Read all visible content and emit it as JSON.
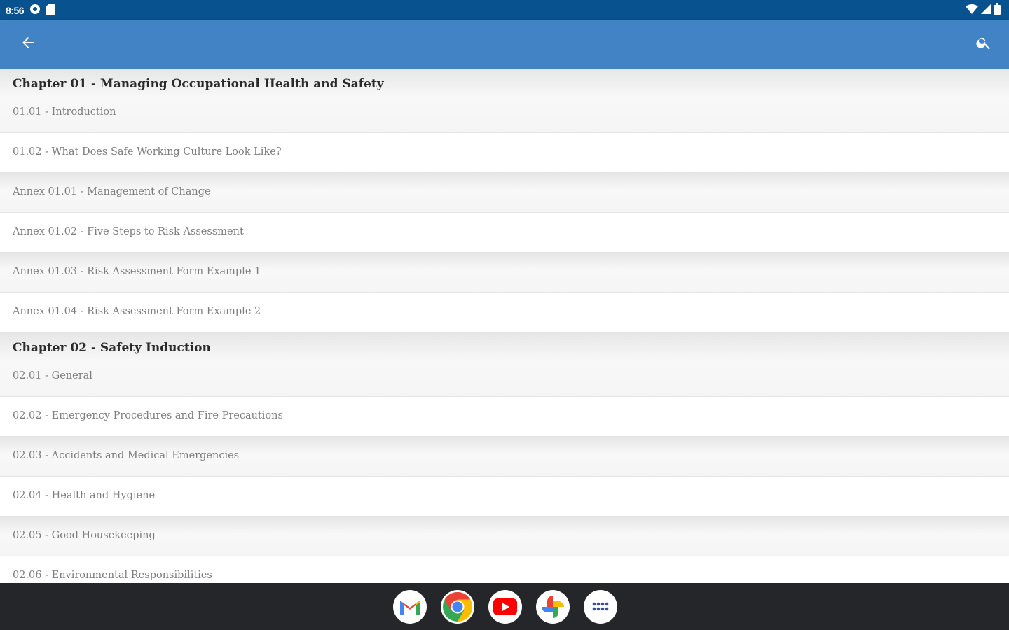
{
  "status_bar": {
    "time": "8:56",
    "icons_left": [
      "settings-icon",
      "sd-card-icon"
    ],
    "icons_right": [
      "wifi-icon",
      "signal-icon",
      "battery-icon"
    ]
  },
  "app_bar": {
    "color": "#4183c4",
    "back_icon": "arrow-back-icon",
    "search_icon": "search-icon"
  },
  "list": [
    {
      "type": "chapter",
      "title": "Chapter 01 - Managing Occupational Health and Safety",
      "first_item": "01.01 - Introduction"
    },
    {
      "type": "item",
      "label": "01.02 - What Does Safe Working Culture Look Like?"
    },
    {
      "type": "item",
      "label": "Annex 01.01 - Management of Change"
    },
    {
      "type": "item",
      "label": "Annex 01.02 - Five Steps to Risk Assessment"
    },
    {
      "type": "item",
      "label": "Annex 01.03 - Risk Assessment Form Example 1"
    },
    {
      "type": "item",
      "label": "Annex 01.04 - Risk Assessment Form Example 2"
    },
    {
      "type": "chapter",
      "title": "Chapter 02 - Safety Induction",
      "first_item": "02.01 - General"
    },
    {
      "type": "item",
      "label": "02.02 - Emergency Procedures and Fire Precautions"
    },
    {
      "type": "item",
      "label": "02.03 - Accidents and Medical Emergencies"
    },
    {
      "type": "item",
      "label": "02.04 - Health and Hygiene"
    },
    {
      "type": "item",
      "label": "02.05 - Good Housekeeping"
    },
    {
      "type": "item",
      "label": "02.06 - Environmental Responsibilities"
    }
  ],
  "dock": [
    {
      "name": "gmail-app-icon"
    },
    {
      "name": "chrome-app-icon"
    },
    {
      "name": "youtube-app-icon"
    },
    {
      "name": "photos-app-icon"
    },
    {
      "name": "app-drawer-icon"
    }
  ]
}
